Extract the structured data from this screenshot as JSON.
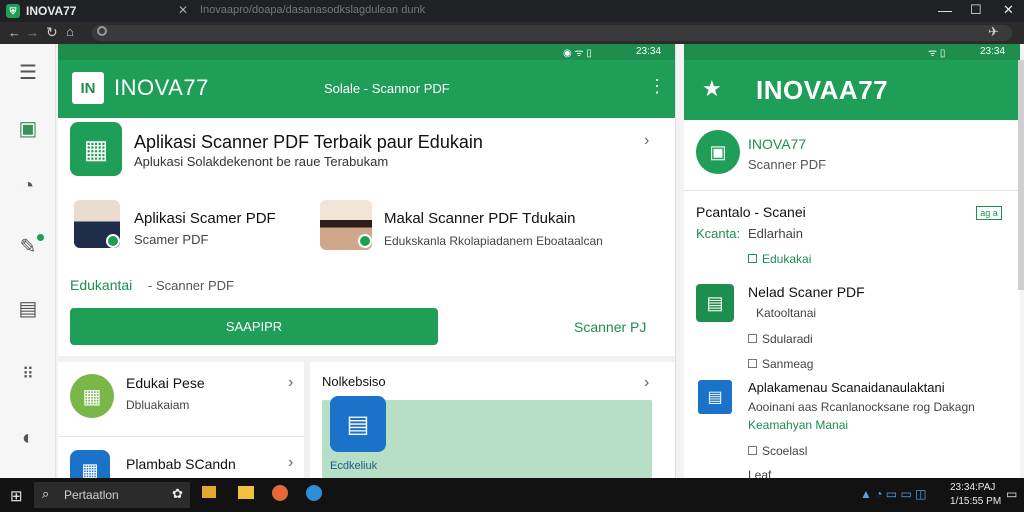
{
  "browser": {
    "tab_title": "INOVA77",
    "tab_url_snippet": "Inovaapro/doapa/dasanasodkslagdulean dunk",
    "address": ""
  },
  "phone1": {
    "status_time": "23:34",
    "brand": "INOVA77",
    "brand_badge": "IN",
    "appbar_sub": "Solale  -  Scannor PDF",
    "hero_title": "Aplikasi Scanner PDF Terbaik paur Edukain",
    "hero_sub": "Aplukasi Solakdekenont be raue Terabukam",
    "card_left_title": "Aplikasi Scamer PDF",
    "card_left_sub": "Scamer PDF",
    "card_right_title": "Makal Scanner PDF Tdukain",
    "card_right_sub": "Edukskanla Rkolapiadanem Eboataalcan",
    "section_label": "Edukantai",
    "section_sub": "- Scanner PDF",
    "primary_button": "SAAPIPR",
    "secondary_link": "Scanner PJ",
    "item1_title": "Edukai Pese",
    "item1_sub": "Dbluakaiam",
    "item2_title": "Plambab SCandn",
    "preview_title": "Nolkebsiso",
    "preview_badge": "Ecdkeliuk"
  },
  "phone2": {
    "status_time": "23:34",
    "brand": "INOVAA77",
    "profile_name": "INOVA77",
    "profile_sub": "Scanner PDF",
    "section_title": "Pcantalo - Scanei",
    "section_tag": "ag a",
    "row1_label": "Kcanta:",
    "row1_value": "Edlarhain",
    "row1_sub": "Edukakai",
    "doc_title": "Nelad Scaner PDF",
    "doc_sub1": "Katooltanai",
    "doc_sub2": "Sdularadi",
    "doc_sub3": "Sanmeag",
    "app_title": "Aplakamenau Scanaidanaulaktani",
    "app_sub": "Aooinani aas Rcanlanocksane rog Dakagn",
    "app_link": "Keamahyan Manai",
    "app_foot": "Scoelasl",
    "bottom": "Leaf"
  },
  "taskbar": {
    "search_placeholder": "Pertaatlon",
    "clock_time": "23:34:PAJ",
    "clock_date": "1/15:55 PM"
  },
  "colors": {
    "brand_green": "#1e9e56",
    "dark_green": "#1e8e4f",
    "blue": "#1a73c9"
  }
}
